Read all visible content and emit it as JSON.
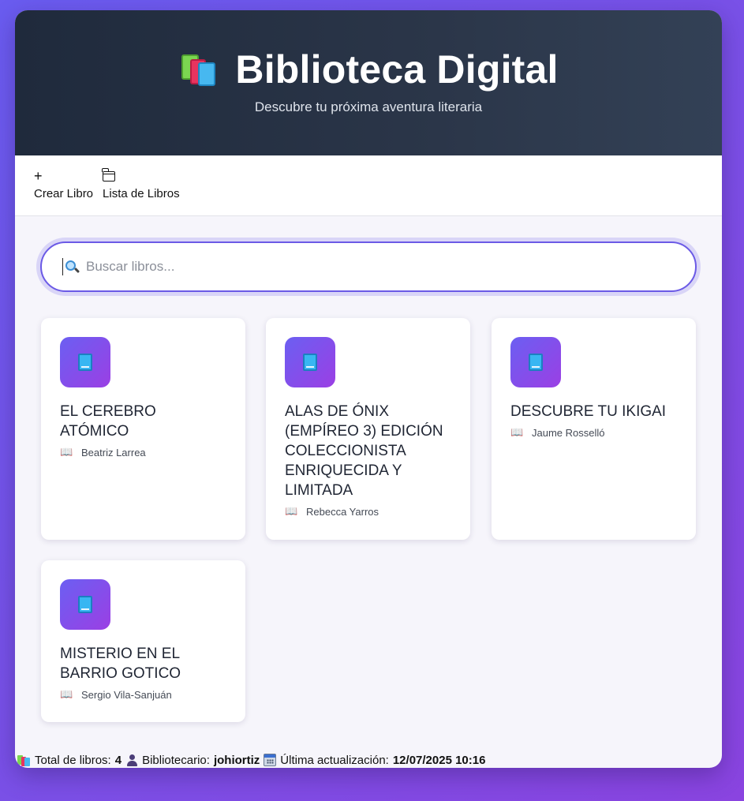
{
  "header": {
    "icon": "books-icon",
    "title": "Biblioteca Digital",
    "subtitle": "Descubre tu próxima aventura literaria"
  },
  "toolbar": {
    "create": {
      "icon": "plus-icon",
      "glyph": "+",
      "label": "Crear Libro"
    },
    "list": {
      "icon": "folder-icon",
      "label": "Lista de Libros"
    }
  },
  "search": {
    "icon": "search-icon",
    "placeholder": "Buscar libros...",
    "value": ""
  },
  "books": [
    {
      "title": "EL CEREBRO ATÓMICO",
      "author": "Beatriz Larrea"
    },
    {
      "title": "ALAS DE ÓNIX (EMPÍREO 3) EDICIÓN COLECCIONISTA ENRIQUECIDA Y LIMITADA",
      "author": "Rebecca Yarros"
    },
    {
      "title": "DESCUBRE TU IKIGAI",
      "author": "Jaume Rosselló"
    },
    {
      "title": "MISTERIO EN EL BARRIO GOTICO",
      "author": "Sergio Vila-Sanjuán"
    }
  ],
  "author_icon_glyph": "📖",
  "footer": {
    "total_label": "Total de libros:",
    "total_value": "4",
    "librarian_label": "Bibliotecario:",
    "librarian_value": "johiortiz",
    "updated_label": "Última actualización:",
    "updated_value": "12/07/2025 10:16"
  },
  "colors": {
    "accent": "#6b5ae6",
    "header_bg": "#1f2a3c",
    "card_icon_gradient": [
      "#6b5ff2",
      "#9b3fe4"
    ]
  }
}
